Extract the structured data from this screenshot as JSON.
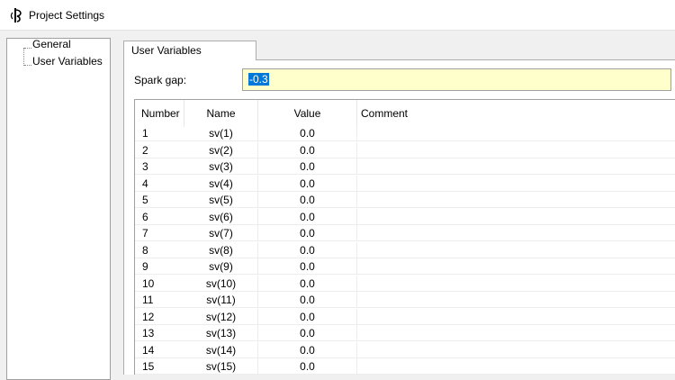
{
  "window": {
    "title": "Project Settings"
  },
  "tree": {
    "items": [
      {
        "label": "General"
      },
      {
        "label": "User Variables"
      }
    ]
  },
  "tab": {
    "label": "User Variables"
  },
  "spark_gap": {
    "label": "Spark gap:",
    "value": "-0.3"
  },
  "table": {
    "columns": [
      "Number",
      "Name",
      "Value",
      "Comment"
    ],
    "rows": [
      {
        "number": "1",
        "name": "sv(1)",
        "value": "0.0",
        "comment": ""
      },
      {
        "number": "2",
        "name": "sv(2)",
        "value": "0.0",
        "comment": ""
      },
      {
        "number": "3",
        "name": "sv(3)",
        "value": "0.0",
        "comment": ""
      },
      {
        "number": "4",
        "name": "sv(4)",
        "value": "0.0",
        "comment": ""
      },
      {
        "number": "5",
        "name": "sv(5)",
        "value": "0.0",
        "comment": ""
      },
      {
        "number": "6",
        "name": "sv(6)",
        "value": "0.0",
        "comment": ""
      },
      {
        "number": "7",
        "name": "sv(7)",
        "value": "0.0",
        "comment": ""
      },
      {
        "number": "8",
        "name": "sv(8)",
        "value": "0.0",
        "comment": ""
      },
      {
        "number": "9",
        "name": "sv(9)",
        "value": "0.0",
        "comment": ""
      },
      {
        "number": "10",
        "name": "sv(10)",
        "value": "0.0",
        "comment": ""
      },
      {
        "number": "11",
        "name": "sv(11)",
        "value": "0.0",
        "comment": ""
      },
      {
        "number": "12",
        "name": "sv(12)",
        "value": "0.0",
        "comment": ""
      },
      {
        "number": "13",
        "name": "sv(13)",
        "value": "0.0",
        "comment": ""
      },
      {
        "number": "14",
        "name": "sv(14)",
        "value": "0.0",
        "comment": ""
      },
      {
        "number": "15",
        "name": "sv(15)",
        "value": "0.0",
        "comment": ""
      }
    ]
  },
  "colors": {
    "selection": "#0078d7",
    "input_background": "#ffffcc"
  },
  "icons": {
    "app": "app-icon"
  }
}
